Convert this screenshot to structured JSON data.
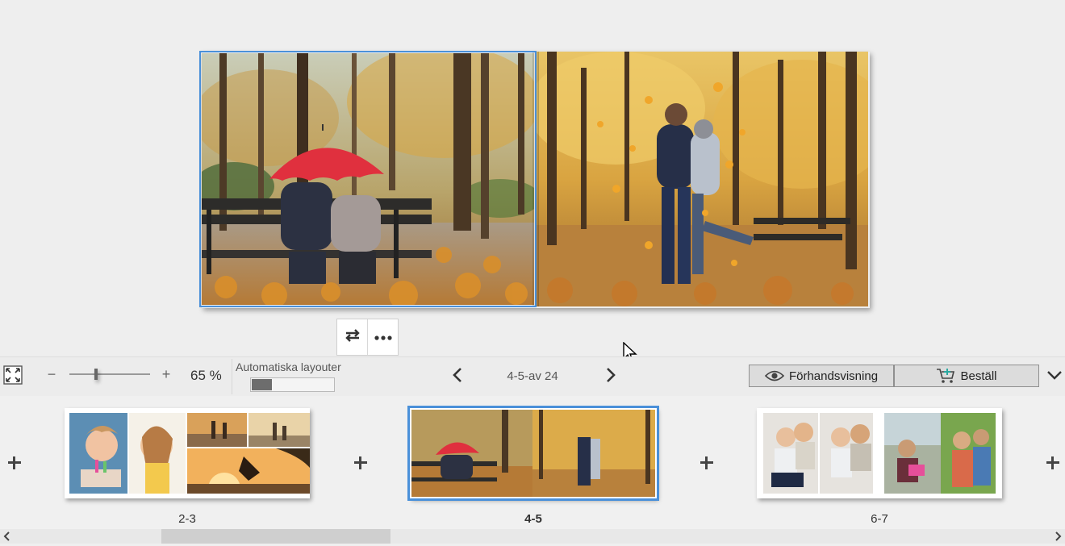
{
  "toolbar": {
    "zoom_out_symbol": "−",
    "zoom_in_symbol": "+",
    "zoom_value": "65 %",
    "zoom_level_fraction": 0.32,
    "auto_layout_label": "Automatiska layouter",
    "auto_layout_progress_fraction": 0.25,
    "page_indicator": "4-5-av 24",
    "preview_label": "Förhandsvisning",
    "order_label": "Beställ"
  },
  "icons": {
    "fit": "fit-to-screen-icon",
    "swap": "swap-arrows-icon",
    "more": "more-dots-icon",
    "prev": "chevron-left-icon",
    "next": "chevron-right-icon",
    "eye": "eye-icon",
    "cart": "cart-icon",
    "collapse": "chevron-down-icon",
    "cursor": "mouse-pointer-icon"
  },
  "thumbnails": [
    {
      "label": "2-3",
      "selected": false
    },
    {
      "label": "4-5",
      "selected": true
    },
    {
      "label": "6-7",
      "selected": false
    }
  ],
  "colors": {
    "selection_blue": "#4a90d9",
    "background": "#eeeeee",
    "umbrella_red": "#e0303e",
    "autumn_orange": "#d98f2b"
  }
}
